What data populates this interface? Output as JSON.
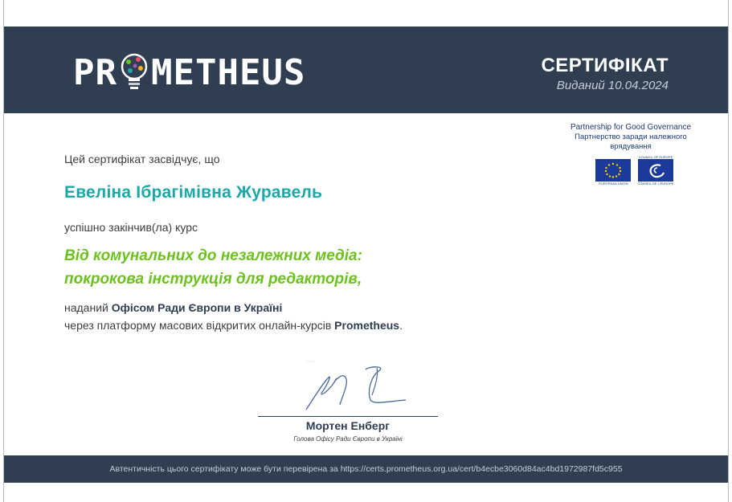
{
  "header": {
    "logo_left": "PR",
    "logo_right": "METHEUS",
    "certificate_label": "СЕРТИФІКАТ",
    "issued": "Виданий 10.04.2024"
  },
  "partnership": {
    "title_en": "Partnership for Good Governance",
    "title_uk": "Партнерство заради належного врядування",
    "eu_caption": "EUROPEAN UNION",
    "coe_top": "COUNCIL OF EUROPE",
    "coe_caption": "CONSEIL DE L'EUROPE"
  },
  "body": {
    "certifies": "Цей сертифікат засвідчує, що",
    "recipient_name": "Евеліна Ібрагімівна Журавель",
    "completed": "успішно закінчив(ла) курс",
    "course_line1": "Від комунальних до незалежних медіа:",
    "course_line2": "покрокова інструкція для редакторів,",
    "provided_prefix": "наданий ",
    "provider": "Офісом Ради Європи в Україні",
    "platform_prefix": "через платформу масових відкритих онлайн-курсів ",
    "platform": "Prometheus",
    "platform_suffix": "."
  },
  "signature": {
    "name": "Мортен Енберг",
    "role": "Голова Офісу Ради Європи в Україні"
  },
  "footer": {
    "verification": "Автентичність цього сертифікату може бути перевірена за https://certs.prometheus.org.ua/cert/b4ecbe3060d84ac4bd1972987fd5c955"
  },
  "colors": {
    "header_bg": "#2f3e51",
    "name": "#1aa8a8",
    "course": "#6cc21c"
  }
}
